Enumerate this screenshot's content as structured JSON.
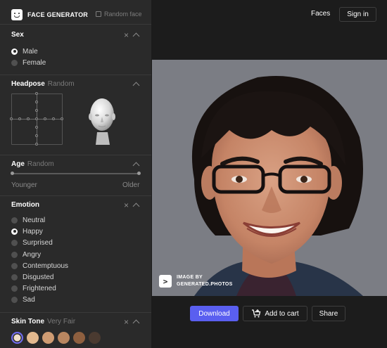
{
  "brand": {
    "name": "FACE GENERATOR",
    "random_face": "Random face"
  },
  "nav": {
    "faces": "Faces",
    "signin": "Sign in"
  },
  "sex": {
    "title": "Sex",
    "options": [
      {
        "label": "Male",
        "selected": true
      },
      {
        "label": "Female",
        "selected": false
      }
    ]
  },
  "headpose": {
    "title": "Headpose",
    "value": "Random"
  },
  "age": {
    "title": "Age",
    "value": "Random",
    "min_label": "Younger",
    "max_label": "Older"
  },
  "emotion": {
    "title": "Emotion",
    "options": [
      {
        "label": "Neutral",
        "selected": false
      },
      {
        "label": "Happy",
        "selected": true
      },
      {
        "label": "Surprised",
        "selected": false
      },
      {
        "label": "Angry",
        "selected": false
      },
      {
        "label": "Contemptuous",
        "selected": false
      },
      {
        "label": "Disgusted",
        "selected": false
      },
      {
        "label": "Frightened",
        "selected": false
      },
      {
        "label": "Sad",
        "selected": false
      }
    ]
  },
  "skin_tone": {
    "title": "Skin Tone",
    "value": "Very Fair",
    "swatches": [
      "#f1e0c9",
      "#e3b98f",
      "#cf9c73",
      "#b98660",
      "#8e5f3f",
      "#4a3a30"
    ],
    "selected_index": 0
  },
  "photo": {
    "credit_line1": "IMAGE BY",
    "credit_line2": "GENERATED.PHOTOS",
    "credit_icon": ">"
  },
  "actions": {
    "download": "Download",
    "add_to_cart": "Add to cart",
    "share": "Share"
  },
  "colors": {
    "accent": "#5a5ff0",
    "sidebar_bg": "#2a2a2a",
    "page_bg": "#1c1c1c"
  }
}
